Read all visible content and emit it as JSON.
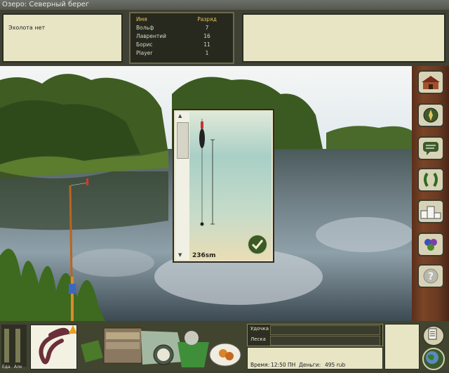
{
  "title": "Озеро: Северный берег",
  "message": "Эхолота нет",
  "players": {
    "header_name": "Имя",
    "header_rank": "Разряд",
    "rows": [
      {
        "name": "Вольф",
        "rank": "7"
      },
      {
        "name": "Лаврентий",
        "rank": "16"
      },
      {
        "name": "Борис",
        "rank": "11"
      },
      {
        "name": "Player",
        "rank": "1"
      }
    ]
  },
  "depth": {
    "value": "236sm"
  },
  "bottom": {
    "food_label": "Еда",
    "alc_label": "Алк",
    "rod_label": "Удочка",
    "line_label": "Леска",
    "time_label": "Время:",
    "time_value": "12:50 ПН",
    "money_label": "Деньги:",
    "money_value": "495 rub"
  },
  "sidebar_icons": [
    "house-icon",
    "compass-icon",
    "chat-icon",
    "laurel-icon",
    "podium-icon",
    "grapes-icon",
    "help-icon"
  ],
  "colors": {
    "panel": "#e7e5c4",
    "frame": "#41442f",
    "rank_header": "#e6c15a"
  }
}
